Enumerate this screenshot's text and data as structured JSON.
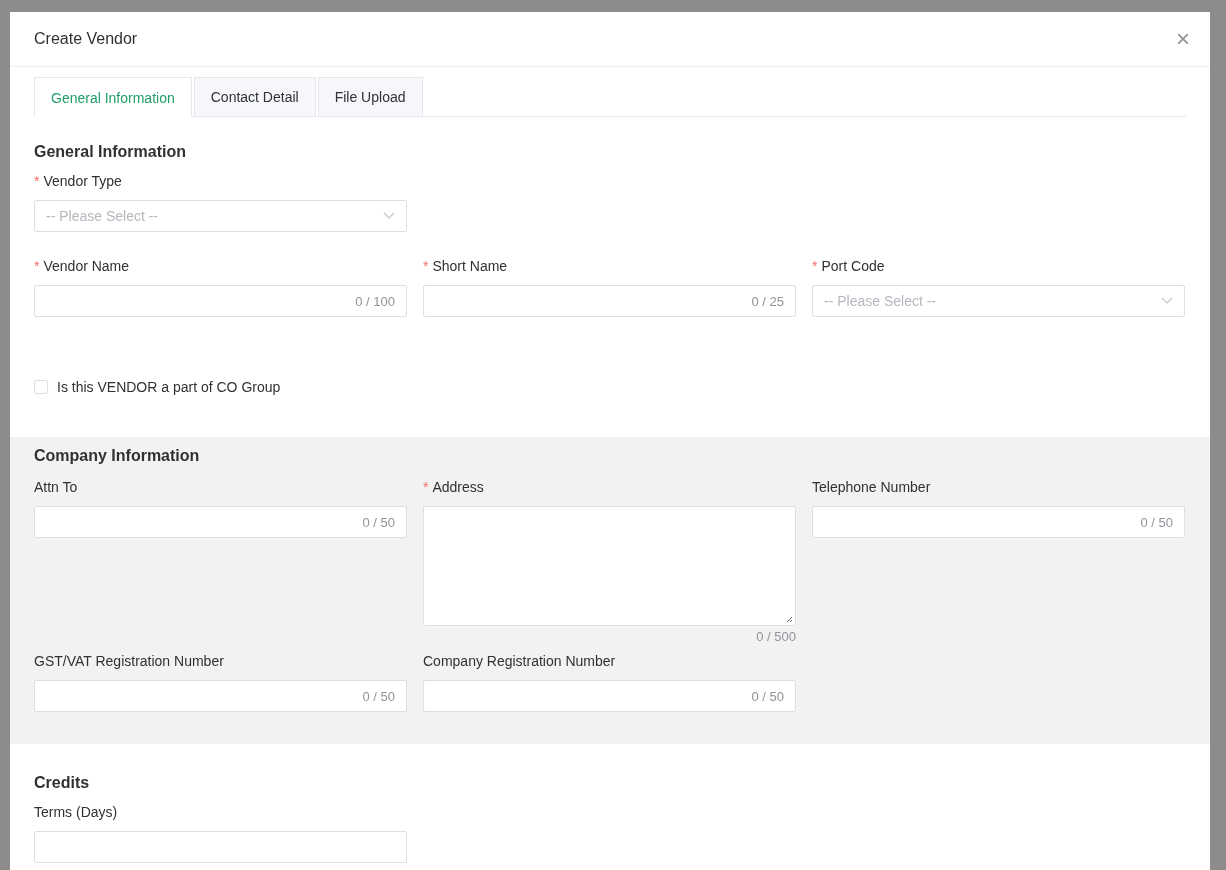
{
  "dialog": {
    "title": "Create Vendor",
    "close_icon": "×"
  },
  "tabs": [
    {
      "label": "General Information",
      "selected": true
    },
    {
      "label": "Contact Detail",
      "selected": false
    },
    {
      "label": "File Upload",
      "selected": false
    }
  ],
  "sections": [
    {
      "title": "General Information",
      "shaded": false,
      "rows": [
        [
          {
            "kind": "select",
            "label": "Vendor Type",
            "mark": "*",
            "placeholder": "-- Please Select --"
          }
        ],
        [
          {
            "kind": "input",
            "label": "Vendor Name",
            "mark": "*",
            "counter": "0 / 100"
          },
          {
            "kind": "input",
            "label": "Short Name",
            "mark": "*",
            "counter": "0 / 25"
          },
          {
            "kind": "select",
            "label": "Port Code",
            "mark": "*",
            "placeholder": "-- Please Select --"
          }
        ],
        [
          {
            "kind": "checkbox",
            "label": "Is this VENDOR a part of CO Group",
            "checked": false
          }
        ]
      ]
    },
    {
      "title": "Company Information",
      "shaded": true,
      "rows": [
        [
          {
            "kind": "input",
            "label": "Attn To",
            "counter": "0 / 50"
          },
          {
            "kind": "textarea",
            "label": "Address",
            "mark": "*",
            "counter": "0 / 500"
          },
          {
            "kind": "input",
            "label": "Telephone Number",
            "counter": "0 / 50"
          }
        ],
        [
          {
            "kind": "input",
            "label": "GST/VAT Registration Number",
            "counter": "0 / 50"
          },
          {
            "kind": "input",
            "label": "Company Registration Number",
            "counter": "0 / 50"
          }
        ]
      ]
    },
    {
      "title": "Credits",
      "shaded": false,
      "rows": [
        [
          {
            "kind": "input",
            "label": "Terms (Days)"
          }
        ]
      ]
    }
  ]
}
